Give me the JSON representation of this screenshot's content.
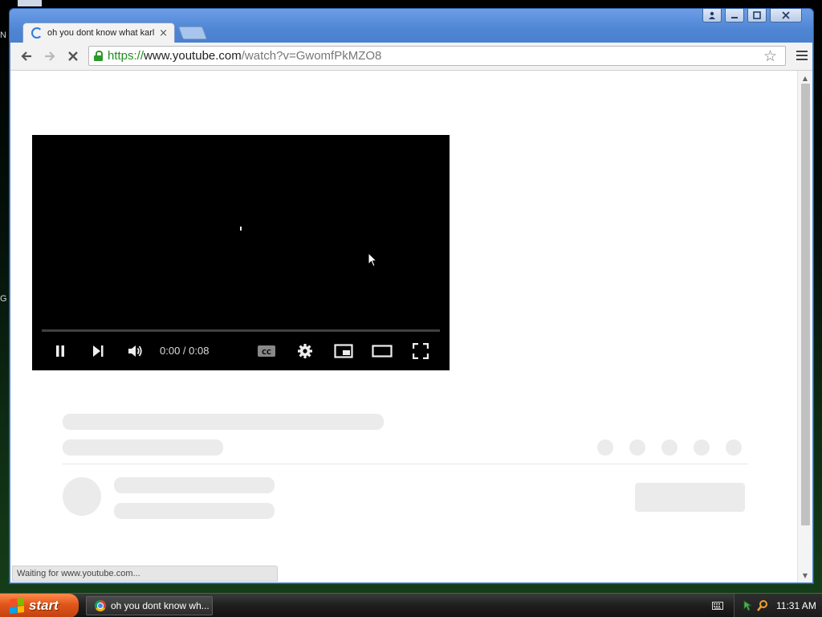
{
  "browser": {
    "tab": {
      "title": "oh you dont know what karls",
      "close_glyph": "×"
    },
    "address": {
      "scheme": "https://",
      "host": "www.youtube.com",
      "path": "/watch?v=GwomfPkMZO8"
    },
    "status_text": "Waiting for www.youtube.com..."
  },
  "player": {
    "time_display": "0:00 / 0:08",
    "progress_fraction": 0,
    "icons": [
      "pause-icon",
      "next-icon",
      "volume-icon",
      "captions-icon",
      "settings-icon",
      "miniplayer-icon",
      "theater-mode-icon",
      "fullscreen-icon"
    ]
  },
  "desktop": {
    "icon_fragments": [
      "N",
      "G"
    ]
  },
  "taskbar": {
    "start_label": "start",
    "task_label": "oh you dont know wh...",
    "clock": "11:31 AM"
  },
  "colors": {
    "window_frame": "#4d86d6",
    "secure_green": "#1f8f1f",
    "start_button": "#e0561a",
    "player_bg": "#000000",
    "skeleton": "#ebebeb"
  }
}
